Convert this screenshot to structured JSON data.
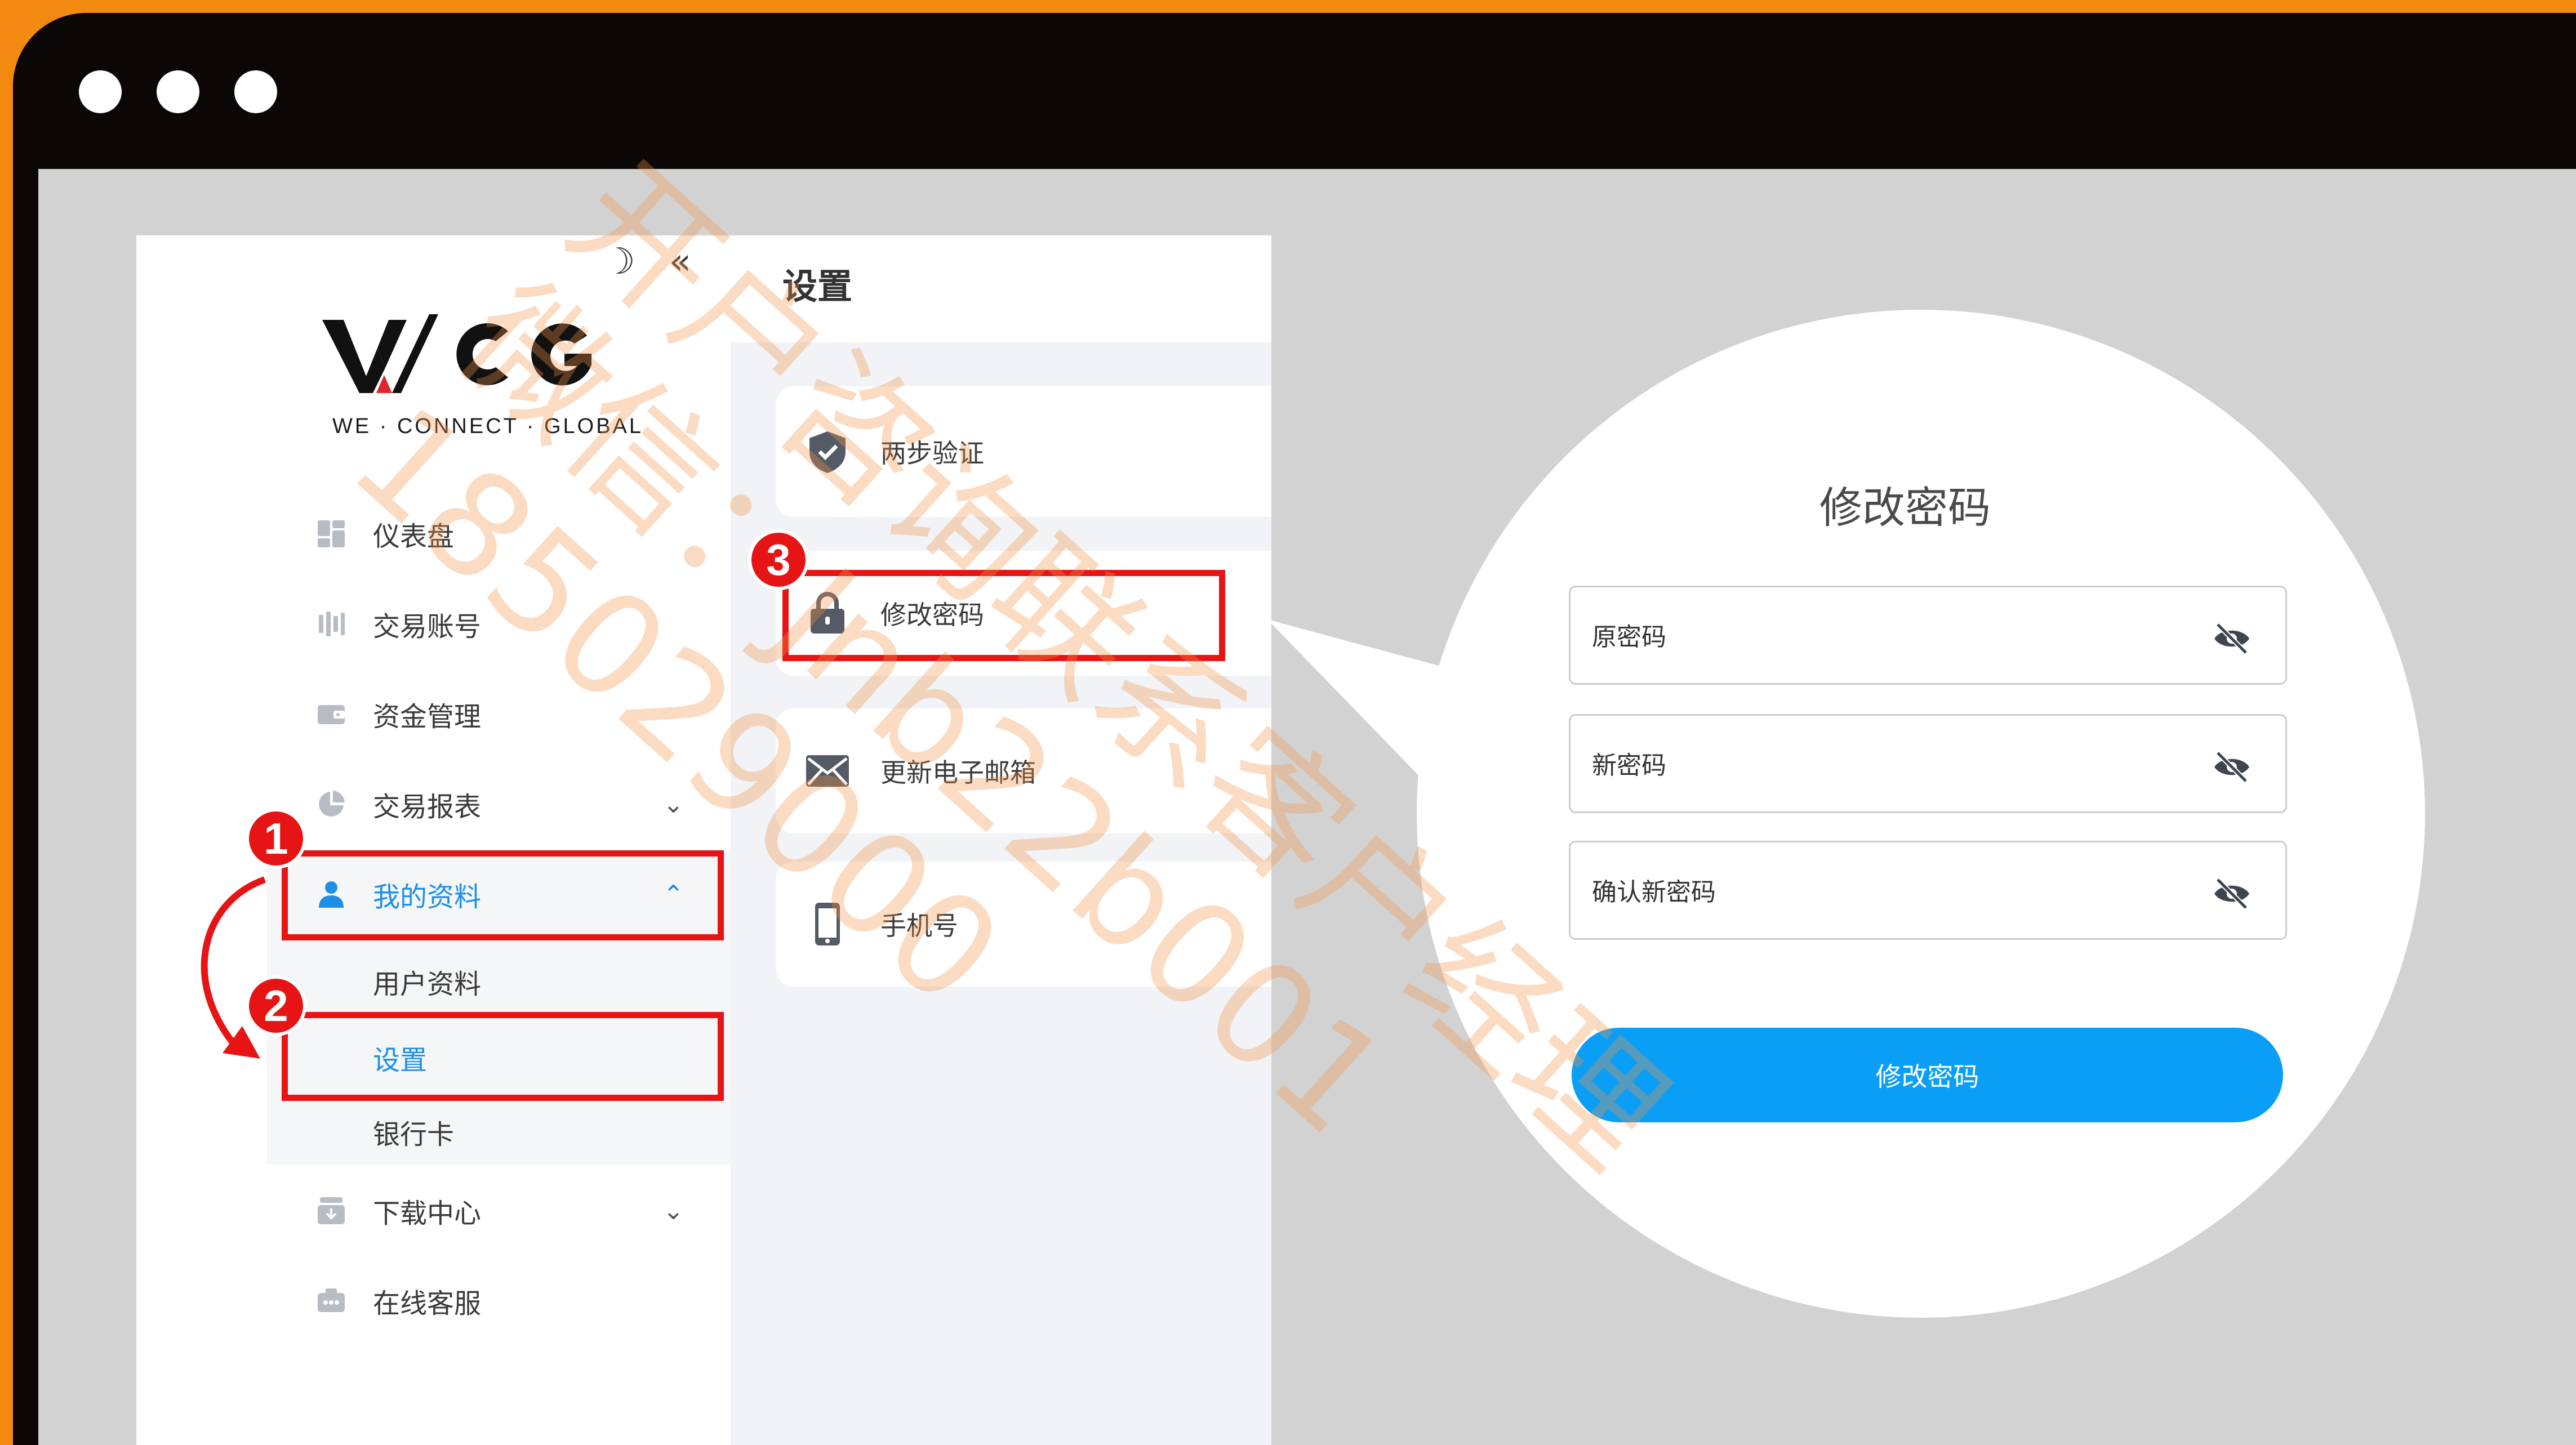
{
  "window": {
    "dots": 3
  },
  "sidebar": {
    "logo_text": "WCG",
    "tagline": "WE · CONNECT · GLOBAL",
    "tool_theme_icon": "moon-icon",
    "tool_collapse_icon": "double-chevron-left-icon",
    "items": [
      {
        "label": "仪表盘",
        "icon": "dashboard-icon"
      },
      {
        "label": "交易账号",
        "icon": "trading-account-icon"
      },
      {
        "label": "资金管理",
        "icon": "wallet-icon"
      },
      {
        "label": "交易报表",
        "icon": "pie-chart-icon",
        "expandable": true
      },
      {
        "label": "我的资料",
        "icon": "user-icon",
        "expanded": true
      },
      {
        "label": "下载中心",
        "icon": "download-icon",
        "expandable": true
      },
      {
        "label": "在线客服",
        "icon": "support-icon"
      }
    ],
    "subitems": [
      {
        "label": "用户资料"
      },
      {
        "label": "设置",
        "active": true
      },
      {
        "label": "银行卡"
      }
    ]
  },
  "settings": {
    "title": "设置",
    "cards": [
      {
        "label": "两步验证",
        "icon": "shield-check-icon"
      },
      {
        "label": "修改密码",
        "icon": "lock-icon"
      },
      {
        "label": "更新电子邮箱",
        "icon": "mail-icon"
      },
      {
        "label": "手机号",
        "icon": "phone-icon"
      }
    ]
  },
  "change_password": {
    "title": "修改密码",
    "fields": [
      {
        "placeholder": "原密码"
      },
      {
        "placeholder": "新密码"
      },
      {
        "placeholder": "确认新密码"
      }
    ],
    "submit_label": "修改密码"
  },
  "steps": [
    "1",
    "2",
    "3"
  ],
  "colors": {
    "accent": "#0a9ef7",
    "highlight": "#e61414",
    "frame": "#f28a12"
  },
  "watermark": {
    "line1": "开户咨询联系客户经理",
    "line2": "微信：Jnb22b001",
    "line3": "185029000"
  }
}
